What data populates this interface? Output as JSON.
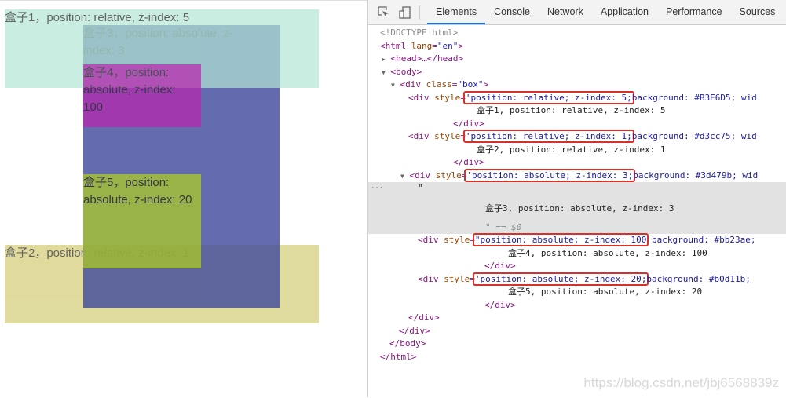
{
  "page": {
    "boxes": [
      {
        "id": "b1",
        "text": "盒子1，position: relative, z-index: 5",
        "color": "#B3E6D5"
      },
      {
        "id": "b2",
        "text": "盒子2，position: relative, z-index: 1",
        "color": "#d3cc75"
      },
      {
        "id": "b3",
        "text": "盒子3，position: absolute, z-index: 3",
        "color": "#3d479b"
      },
      {
        "id": "b4",
        "text": "盒子4，position: absolute, z-index: 100",
        "color": "#bb23ae"
      },
      {
        "id": "b5",
        "text": "盒子5，position: absolute, z-index: 20",
        "color": "#b0d11b"
      }
    ]
  },
  "devtools": {
    "icons": [
      "inspect-element-icon",
      "device-toolbar-icon"
    ],
    "tabs": [
      "Elements",
      "Console",
      "Network",
      "Application",
      "Performance",
      "Sources"
    ],
    "active_tab": "Elements",
    "tree": {
      "doctype": "<!DOCTYPE html>",
      "html_open": "<html",
      "html_attr": "lang",
      "html_val": "\"en\"",
      "head": "<head>…</head>",
      "body_open": "<body>",
      "div_box_open": "<div",
      "div_box_attr": "class",
      "div_box_val": "\"box\"",
      "div_open": "<div",
      "style_attr": "style",
      "div1_hl": "'position: relative; z-index: 5;",
      "div1_rest": "background: #B3E6D5; wid",
      "div1_text": "盒子1, position: relative, z-index: 5",
      "div2_hl": "'position: relative; z-index: 1;",
      "div2_rest": "background: #d3cc75; wid",
      "div2_text": "盒子2, position: relative, z-index: 1",
      "div3_hl": "'position: absolute; z-index: 3;",
      "div3_rest": "background: #3d479b; wid",
      "div3_quote": "\"",
      "div3_text": "盒子3, position: absolute, z-index: 3",
      "div3_eq": "\" == $0",
      "div4_hl": "\"position: absolute; z-index: 100",
      "div4_rest": "background: #bb23ae;",
      "div4_text": "盒子4, position: absolute, z-index: 100",
      "div5_hl": "'position: absolute; z-index: 20;",
      "div5_rest": "background: #b0d11b;",
      "div5_text": "盒子5, position: absolute, z-index: 20",
      "div_close": "</div>",
      "body_close": "</body>",
      "html_close": "</html>",
      "dots": "···"
    }
  },
  "watermark": "https://blog.csdn.net/jbj6568839z"
}
